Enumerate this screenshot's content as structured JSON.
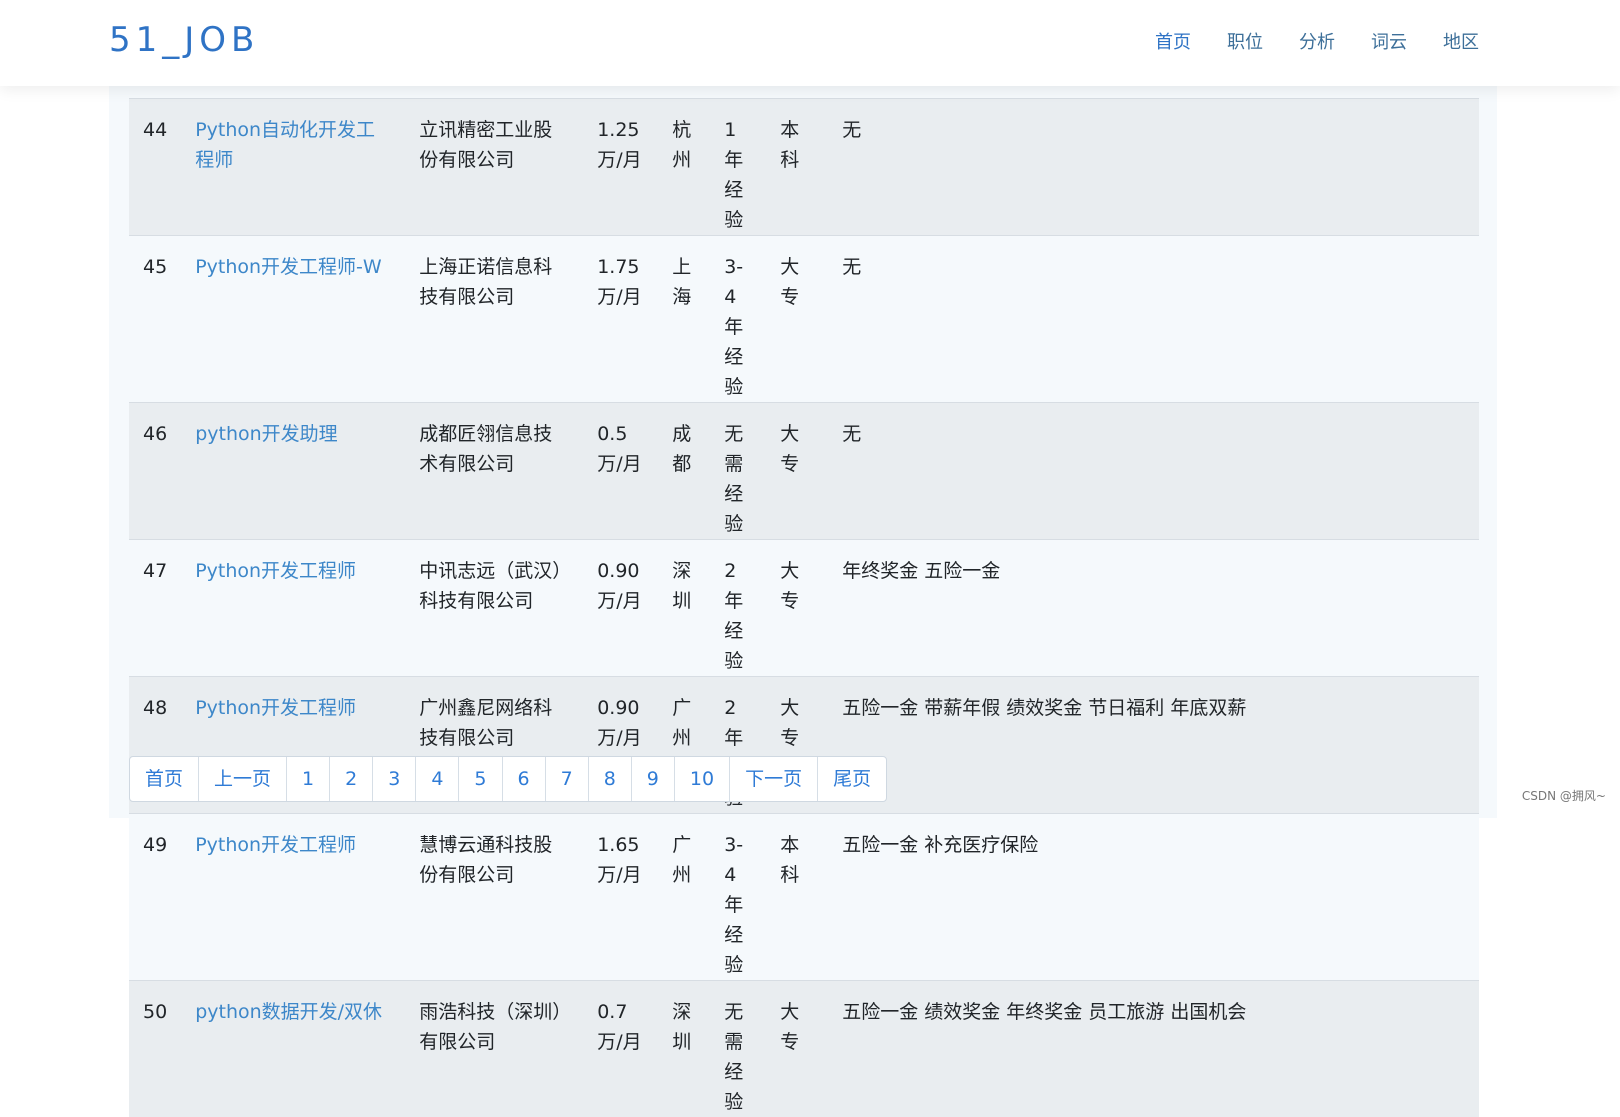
{
  "brand": "51_JOB",
  "nav": [
    "首页",
    "职位",
    "分析",
    "词云",
    "地区"
  ],
  "rows": [
    {
      "num": "44",
      "title": "Python自动化开发工程师",
      "company": "立讯精密工业股份有限公司",
      "salary": "1.25万/月",
      "city": "杭州",
      "exp": "1年经验",
      "edu": "本科",
      "welfare": "无"
    },
    {
      "num": "45",
      "title": "Python开发工程师-W",
      "company": "上海正诺信息科技有限公司",
      "salary": "1.75万/月",
      "city": "上海",
      "exp": "3-4年经验",
      "edu": "大专",
      "welfare": "无"
    },
    {
      "num": "46",
      "title": "python开发助理",
      "company": "成都匠翎信息技术有限公司",
      "salary": "0.5万/月",
      "city": "成都",
      "exp": "无需经验",
      "edu": "大专",
      "welfare": "无"
    },
    {
      "num": "47",
      "title": "Python开发工程师",
      "company": "中讯志远（武汉）科技有限公司",
      "salary": "0.90万/月",
      "city": "深圳",
      "exp": "2年经验",
      "edu": "大专",
      "welfare": "年终奖金 五险一金"
    },
    {
      "num": "48",
      "title": "Python开发工程师",
      "company": "广州鑫尼网络科技有限公司",
      "salary": "0.90万/月",
      "city": "广州",
      "exp": "2年经验",
      "edu": "大专",
      "welfare": "五险一金 带薪年假 绩效奖金 节日福利 年底双薪"
    },
    {
      "num": "49",
      "title": "Python开发工程师",
      "company": "慧博云通科技股份有限公司",
      "salary": "1.65万/月",
      "city": "广州",
      "exp": "3-4年经验",
      "edu": "本科",
      "welfare": "五险一金 补充医疗保险"
    },
    {
      "num": "50",
      "title": "python数据开发/双休",
      "company": "雨浩科技（深圳）有限公司",
      "salary": "0.7万/月",
      "city": "深圳",
      "exp": "无需经验",
      "edu": "大专",
      "welfare": "五险一金 绩效奖金 年终奖金 员工旅游 出国机会"
    }
  ],
  "pagination": [
    "首页",
    "上一页",
    "1",
    "2",
    "3",
    "4",
    "5",
    "6",
    "7",
    "8",
    "9",
    "10",
    "下一页",
    "尾页"
  ],
  "watermark": "CSDN @拥风~"
}
